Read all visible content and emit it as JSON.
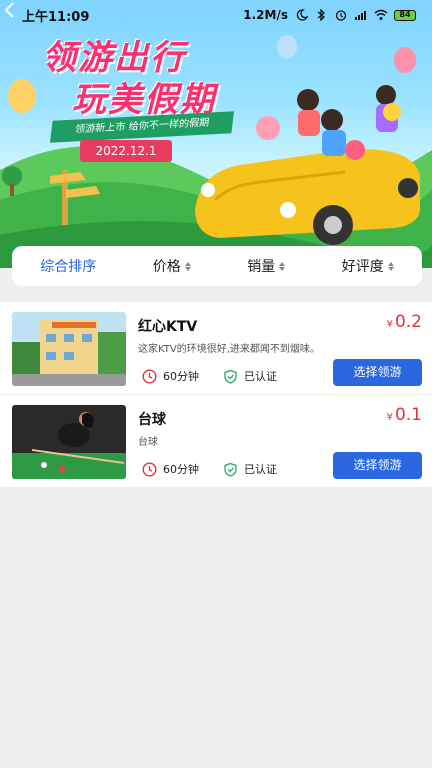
{
  "status_bar": {
    "time": "上午11:09",
    "network_speed": "1.2M/s",
    "battery": "84"
  },
  "banner": {
    "title_line1": "领游出行",
    "title_line2": "玩美假期",
    "ribbon_text": "领游新上市  给你不一样的假期",
    "date": "2022.12.1"
  },
  "filters": {
    "tabs": [
      {
        "label": "综合排序",
        "active": true,
        "sortable": false
      },
      {
        "label": "价格",
        "active": false,
        "sortable": true
      },
      {
        "label": "销量",
        "active": false,
        "sortable": true
      },
      {
        "label": "好评度",
        "active": false,
        "sortable": true
      }
    ]
  },
  "items": [
    {
      "title": "红心KTV",
      "price_symbol": "¥",
      "price": "0.2",
      "description": "这家KTV的环境很好,进来都闻不到烟味。",
      "duration": "60分钟",
      "verified": "已认证",
      "button": "选择领游"
    },
    {
      "title": "台球",
      "price_symbol": "¥",
      "price": "0.1",
      "description": "台球",
      "duration": "60分钟",
      "verified": "已认证",
      "button": "选择领游"
    }
  ],
  "colors": {
    "accent": "#2a67e0",
    "price": "#e0343a",
    "title_pink": "#ff2f6f",
    "background": "#efefef"
  }
}
